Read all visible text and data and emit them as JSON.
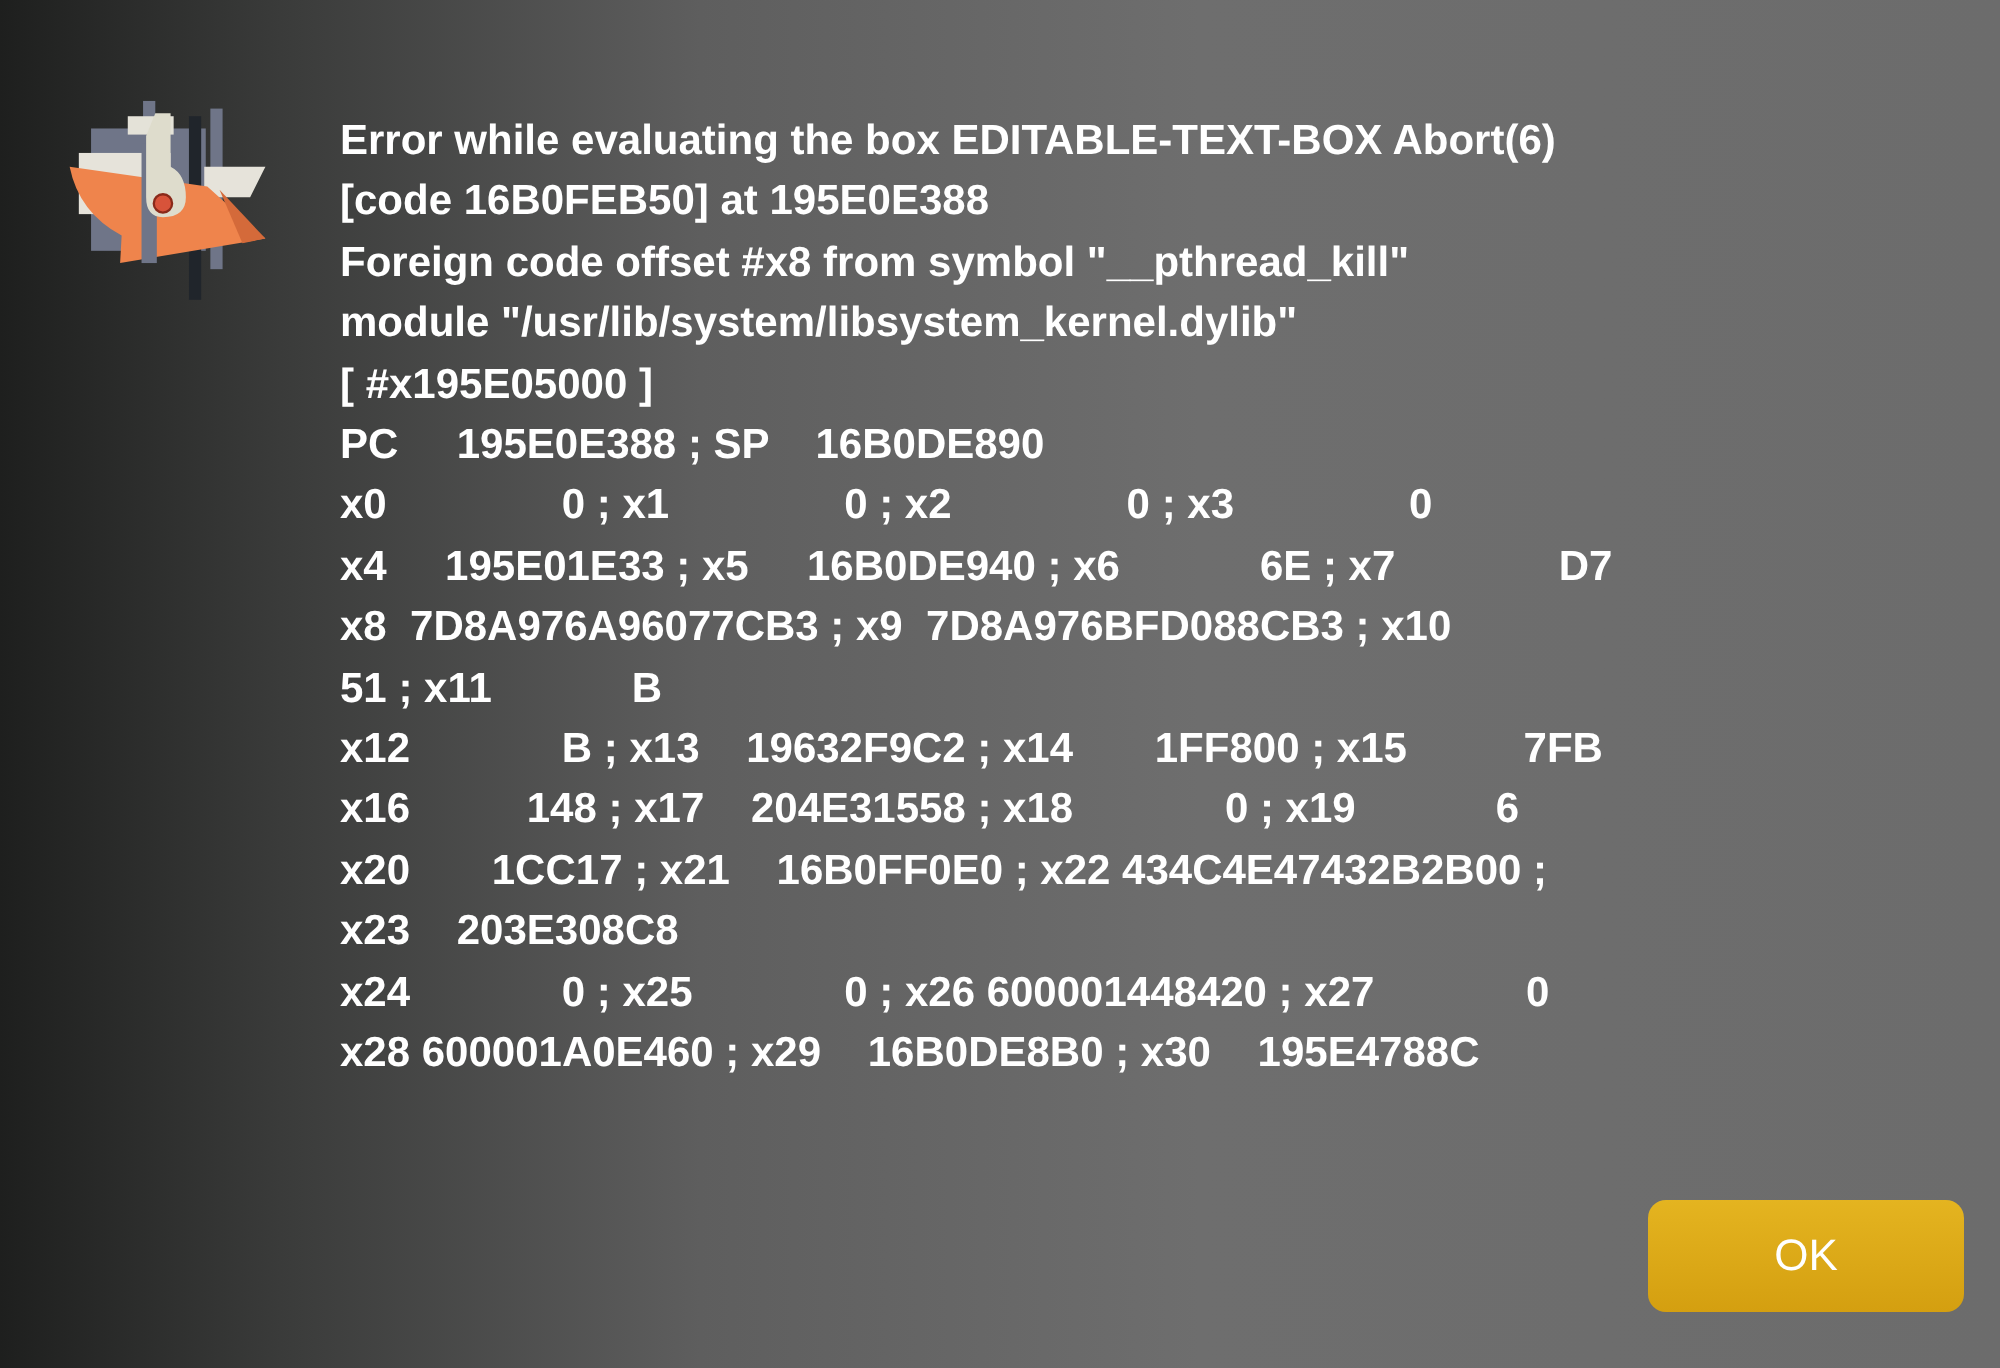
{
  "message_lines": [
    "Error while evaluating the box EDITABLE-TEXT-BOX Abort(6)",
    "[code 16B0FEB50] at 195E0E388",
    "Foreign code offset #x8 from symbol \"__pthread_kill\"",
    "module \"/usr/lib/system/libsystem_kernel.dylib\"",
    "[ #x195E05000 ]",
    "PC     195E0E388 ; SP    16B0DE890",
    "x0               0 ; x1               0 ; x2               0 ; x3               0",
    "x4     195E01E33 ; x5     16B0DE940 ; x6            6E ; x7              D7",
    "x8  7D8A976A96077CB3 ; x9  7D8A976BFD088CB3 ; x10",
    "51 ; x11            B",
    "x12             B ; x13    19632F9C2 ; x14       1FF800 ; x15          7FB",
    "x16          148 ; x17    204E31558 ; x18             0 ; x19            6",
    "x20       1CC17 ; x21    16B0FF0E0 ; x22 434C4E47432B2B00 ;",
    "x23    203E308C8",
    "x24             0 ; x25             0 ; x26 600001448420 ; x27             0",
    "x28 600001A0E460 ; x29    16B0DE8B0 ; x30    195E4788C"
  ],
  "buttons": [
    {
      "label": "OK",
      "kind": "default"
    }
  ]
}
